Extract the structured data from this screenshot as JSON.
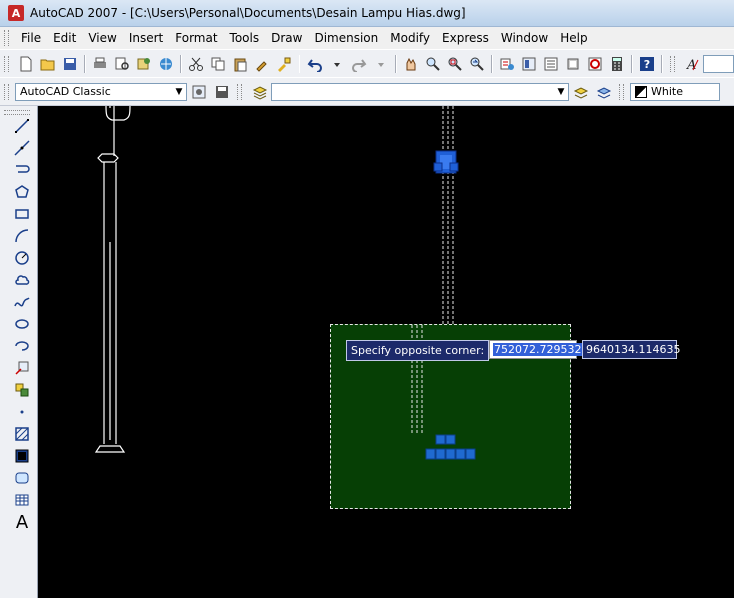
{
  "window": {
    "title": "AutoCAD 2007 - [C:\\Users\\Personal\\Documents\\Desain Lampu Hias.dwg]",
    "app_icon": "A"
  },
  "menu": {
    "items": [
      "File",
      "Edit",
      "View",
      "Insert",
      "Format",
      "Tools",
      "Draw",
      "Dimension",
      "Modify",
      "Express",
      "Window",
      "Help"
    ]
  },
  "standard_toolbar": {
    "icons": [
      "new-icon",
      "open-icon",
      "save-icon",
      "plot-icon",
      "plot-preview-icon",
      "publish-icon",
      "3d-dwf-icon",
      "cut-icon",
      "copy-icon",
      "paste-icon",
      "match-properties-icon",
      "block-editor-icon",
      "undo-icon",
      "redo-icon",
      "pan-icon",
      "zoom-realtime-icon",
      "zoom-window-icon",
      "zoom-previous-icon",
      "properties-icon",
      "design-center-icon",
      "tool-palettes-icon",
      "sheet-set-icon",
      "markup-icon",
      "calculator-icon",
      "help-icon",
      "text-style-icon"
    ]
  },
  "workspace_toolbar": {
    "workspace": "AutoCAD Classic",
    "layer_value": "",
    "color_value": "White"
  },
  "draw_toolbar": {
    "tools": [
      "line-icon",
      "construction-line-icon",
      "polyline-icon",
      "polygon-icon",
      "rectangle-icon",
      "arc-icon",
      "circle-icon",
      "revision-cloud-icon",
      "spline-icon",
      "ellipse-icon",
      "ellipse-arc-icon",
      "insert-block-icon",
      "make-block-icon",
      "point-icon",
      "hatch-icon",
      "gradient-icon",
      "region-icon",
      "table-icon",
      "multiline-text-icon"
    ],
    "mtext_glyph": "A"
  },
  "command": {
    "prompt": "Specify opposite corner:",
    "x_value": "752072.729532",
    "y_value": "9640134.114635"
  },
  "colors": {
    "canvas": "#000000",
    "selection_window": "#063f05",
    "grip": "#1f5fd6",
    "tooltip": "#1c2a6a"
  }
}
